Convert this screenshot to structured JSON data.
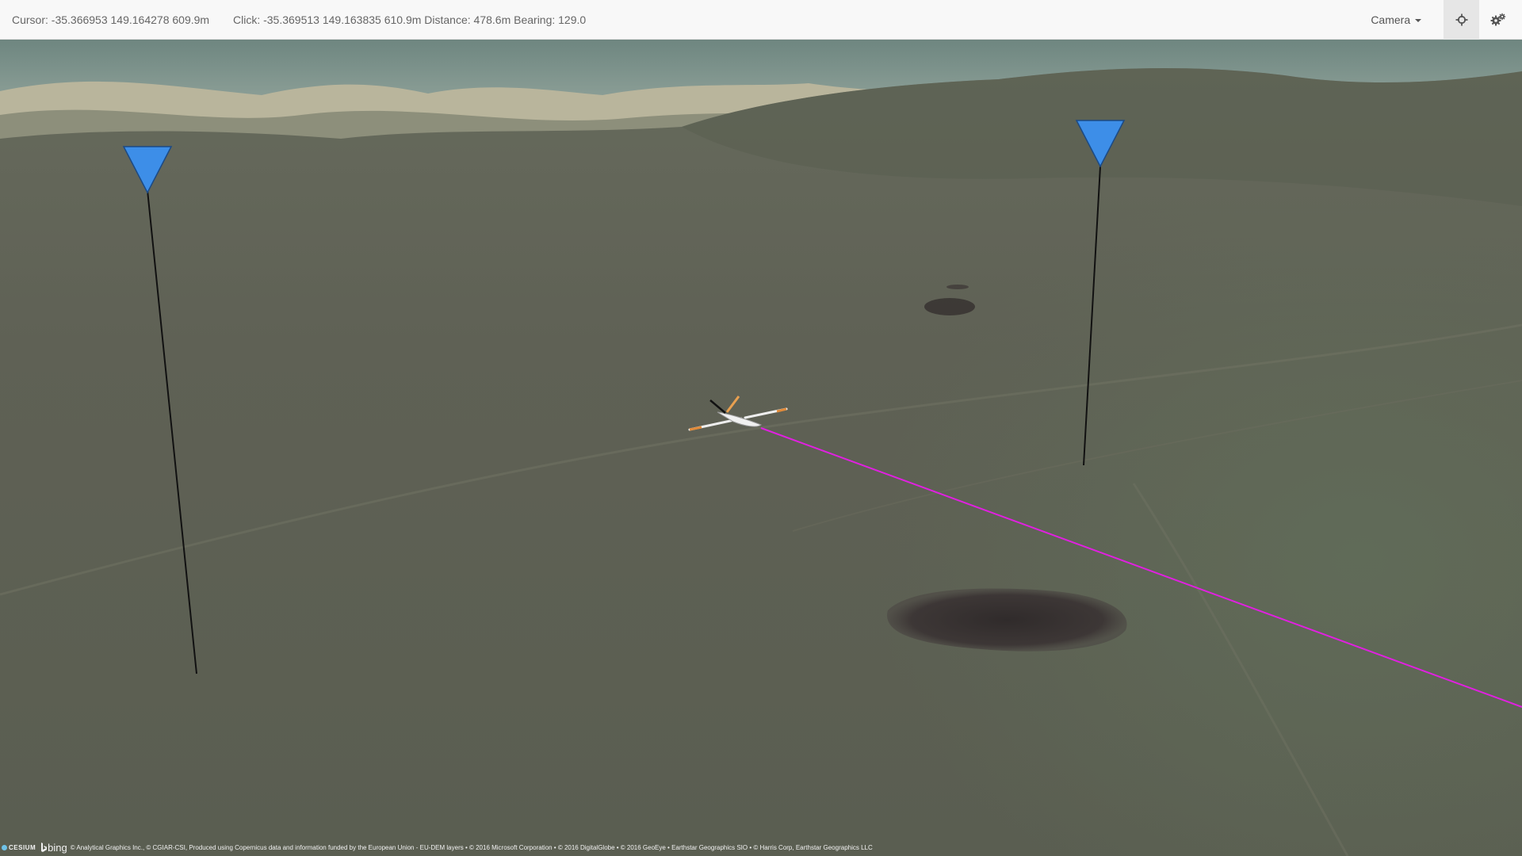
{
  "toolbar": {
    "cursor_readout": "Cursor: -35.366953 149.164278 609.9m",
    "click_readout": "Click: -35.369513 149.163835 610.9m Distance: 478.6m Bearing: 129.0",
    "camera_label": "Camera",
    "center_icon": "crosshair-icon",
    "settings_icon": "gears-icon"
  },
  "map": {
    "waypoint_color": "#3d8ee8",
    "flight_path_color": "#e020e0",
    "vehicle": "fixed-wing-aircraft"
  },
  "attribution": {
    "cesium_logo": "CESIUM",
    "bing_logo": "bing",
    "text": "© Analytical Graphics Inc., © CGIAR-CSI, Produced using Copernicus data and information funded by the European Union - EU-DEM layers • © 2016 Microsoft Corporation • © 2016 DigitalGlobe • © 2016 GeoEye • Earthstar Geographics SIO • © Harris Corp, Earthstar Geographics LLC"
  }
}
